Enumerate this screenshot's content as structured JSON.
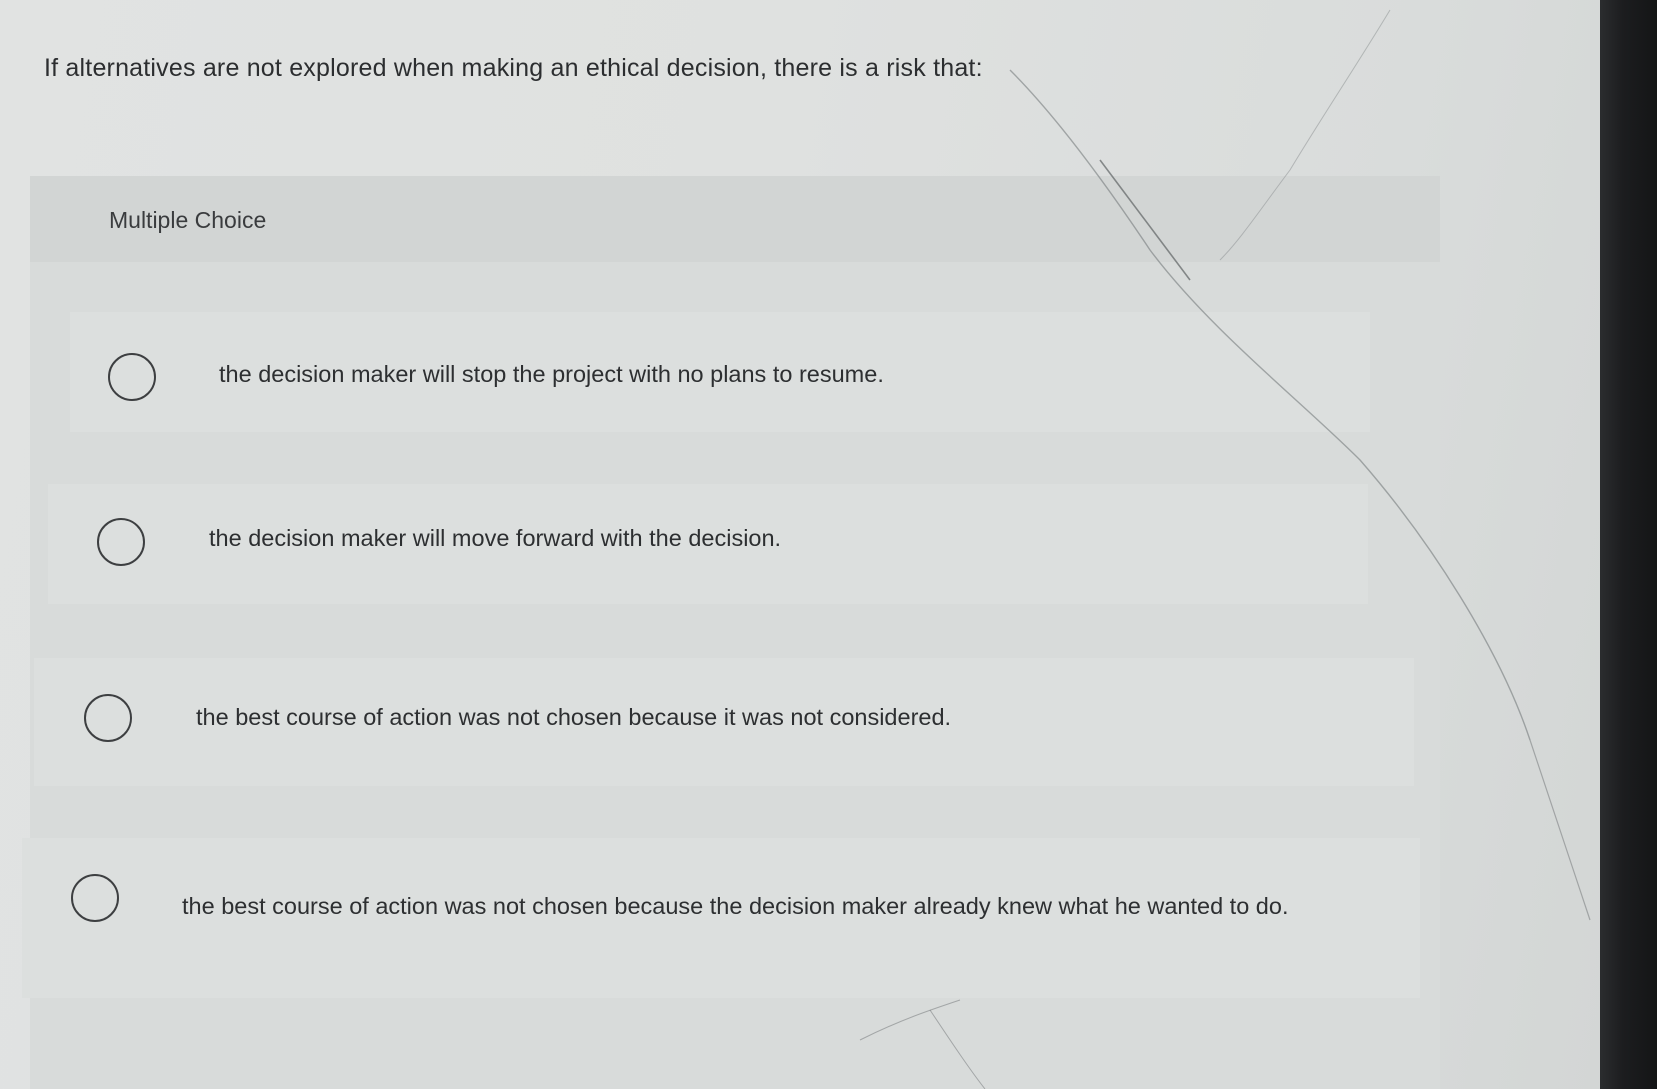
{
  "question": {
    "text": "If alternatives are not explored when making an ethical decision, there is a risk that:"
  },
  "question_type": {
    "label": "Multiple Choice"
  },
  "choices": [
    {
      "text": "the decision maker will stop the project with no plans to resume."
    },
    {
      "text": "the decision maker will move forward with the decision."
    },
    {
      "text": "the best course of action was not chosen because it was not considered."
    },
    {
      "text": "the best course of action was not chosen because the decision maker already knew what he wanted to do."
    }
  ]
}
